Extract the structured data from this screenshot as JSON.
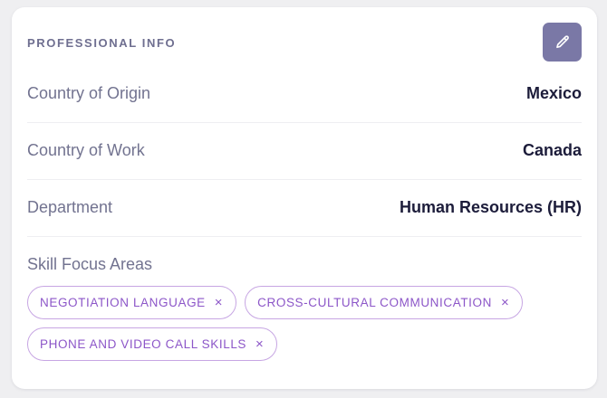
{
  "card": {
    "title": "PROFESSIONAL INFO",
    "edit_icon": "pencil-icon"
  },
  "fields": [
    {
      "label": "Country of Origin",
      "value": "Mexico"
    },
    {
      "label": "Country of Work",
      "value": "Canada"
    },
    {
      "label": "Department",
      "value": "Human Resources (HR)"
    }
  ],
  "skills": {
    "label": "Skill Focus Areas",
    "remove_symbol": "×",
    "items": [
      "NEGOTIATION LANGUAGE",
      "CROSS-CULTURAL COMMUNICATION",
      "PHONE AND VIDEO CALL SKILLS"
    ]
  },
  "colors": {
    "accent": "#7a78a6",
    "chip_text": "#8c56c8",
    "chip_border": "#c7a6e3"
  }
}
